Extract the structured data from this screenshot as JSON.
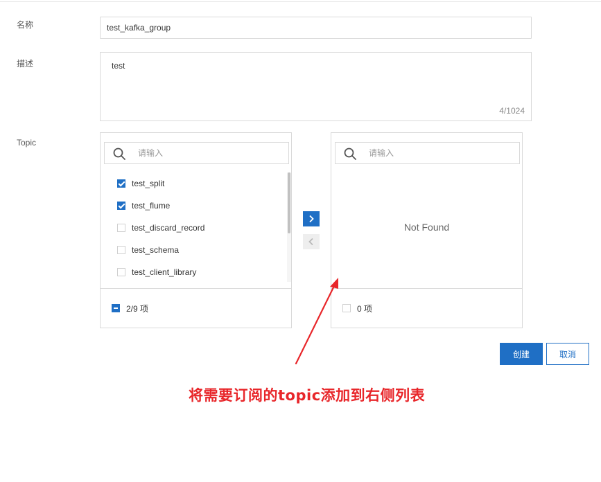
{
  "form": {
    "name_label": "名称",
    "name_value": "test_kafka_group",
    "desc_label": "描述",
    "desc_value": "test",
    "desc_count": "4/1024",
    "topic_label": "Topic"
  },
  "transfer": {
    "left": {
      "search_placeholder": "请输入",
      "items": [
        {
          "label": "test_split",
          "checked": true
        },
        {
          "label": "test_flume",
          "checked": true
        },
        {
          "label": "test_discard_record",
          "checked": false
        },
        {
          "label": "test_schema",
          "checked": false
        },
        {
          "label": "test_client_library",
          "checked": false
        }
      ],
      "footer": "2/9 项"
    },
    "right": {
      "search_placeholder": "请输入",
      "empty_text": "Not Found",
      "footer": "0 项"
    }
  },
  "actions": {
    "create_label": "创建",
    "cancel_label": "取消"
  },
  "annotation": {
    "text": "将需要订阅的topic添加到右侧列表",
    "color": "#e8262a"
  },
  "colors": {
    "primary": "#1f6fc5",
    "border": "#d9d9d9"
  }
}
